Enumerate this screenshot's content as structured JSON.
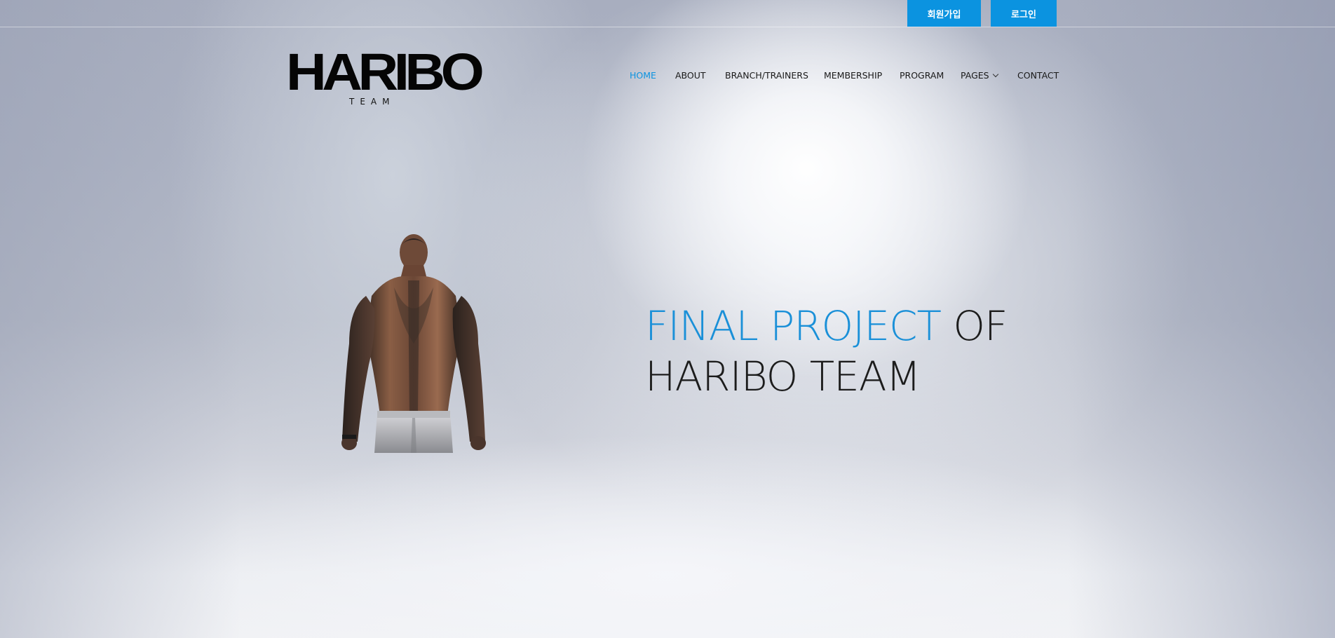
{
  "topbar": {
    "signup_label": "회원가입",
    "login_label": "로그인"
  },
  "logo": {
    "main": "HARIBO",
    "sub": "TEAM"
  },
  "nav": {
    "items": [
      {
        "label": "HOME",
        "active": true
      },
      {
        "label": "ABOUT"
      },
      {
        "label": "BRANCH/TRAINERS"
      },
      {
        "label": "MEMBERSHIP"
      },
      {
        "label": "PROGRAM"
      },
      {
        "label": "PAGES",
        "has_dropdown": true
      },
      {
        "label": "CONTACT"
      }
    ]
  },
  "hero": {
    "headline_highlight": "FINAL PROJECT",
    "headline_rest": "OF",
    "headline_line2": "HARIBO TEAM"
  },
  "colors": {
    "accent": "#0b93e0",
    "text": "#1a1a1a"
  }
}
